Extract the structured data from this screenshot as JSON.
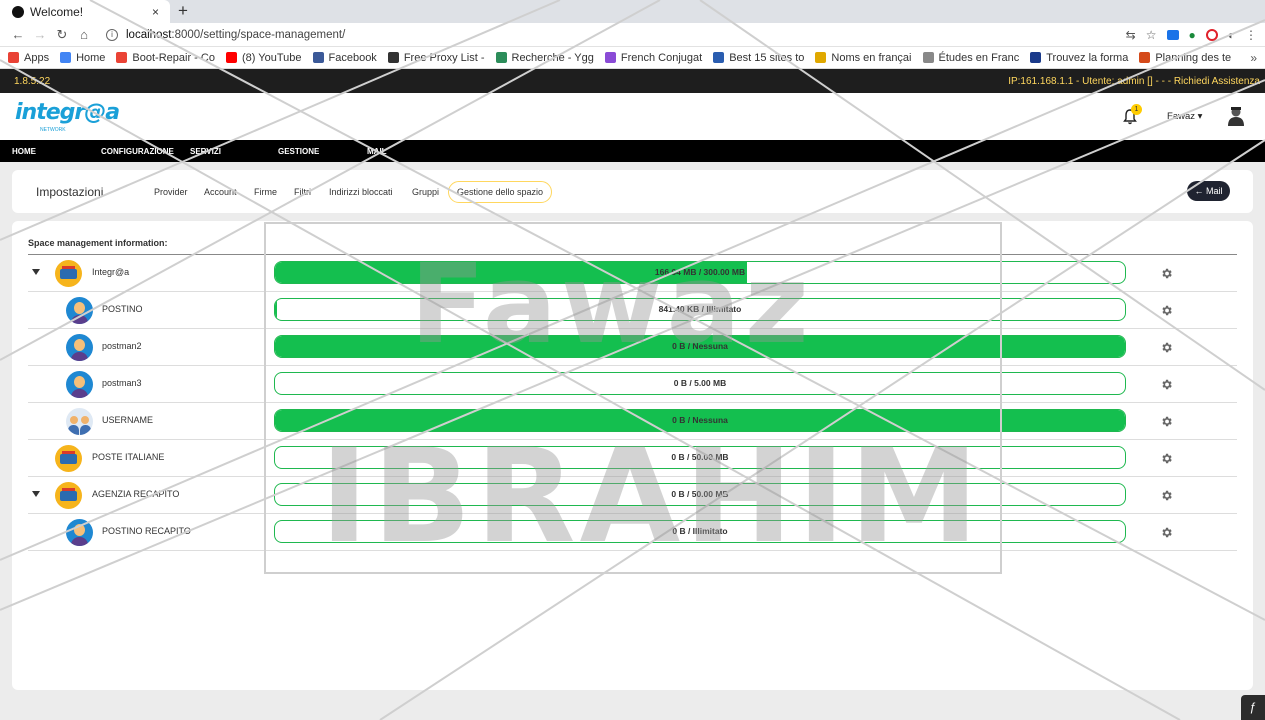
{
  "browser": {
    "tab_title": "Welcome!",
    "tab_close": "×",
    "new_tab": "+",
    "url_host": "localhost",
    "url_path": ":8000/setting/space-management/",
    "bookmarks": [
      {
        "label": "Apps",
        "color": "#e94235"
      },
      {
        "label": "Home",
        "color": "#4285f4"
      },
      {
        "label": "Boot-Repair - Co",
        "color": "#ea4335"
      },
      {
        "label": "(8) YouTube",
        "color": "#ff0000"
      },
      {
        "label": "Facebook",
        "color": "#3b5998"
      },
      {
        "label": "Free Proxy List -",
        "color": "#333333"
      },
      {
        "label": "Recherche - Ygg",
        "color": "#2c8d5a"
      },
      {
        "label": "French Conjugat",
        "color": "#8a4bd6"
      },
      {
        "label": "Best 15 sites to",
        "color": "#2a5db0"
      },
      {
        "label": "Noms en françai",
        "color": "#e0a800"
      },
      {
        "label": "Études en Franc",
        "color": "#888888"
      },
      {
        "label": "Trouvez la forma",
        "color": "#1a3a8a"
      },
      {
        "label": "Planning des te",
        "color": "#d44a1a"
      }
    ],
    "bookmarks_more": "»"
  },
  "statusbar": {
    "version": "1.8.5.22",
    "info": "IP:161.168.1.1 - Utente: admin [] - - - Richiedi Assistenza"
  },
  "header": {
    "logo_text": "integr@a",
    "logo_sub": "NETWORK",
    "notif_count": "1",
    "username": "Fawaz"
  },
  "mainnav": [
    "HOME",
    "CONFIGURAZIONE",
    "SERVIZI",
    "GESTIONE",
    "MAIL"
  ],
  "subnav": {
    "heading": "Impostazioni",
    "links": [
      "Provider",
      "Account",
      "Firme",
      "Filtri",
      "Indirizzi bloccati",
      "Gruppi",
      "Gestione dello spazio"
    ],
    "active_index": 6,
    "mail_button": "Mail"
  },
  "panel": {
    "title": "Space management information:",
    "rows": [
      {
        "label": "Integr@a",
        "icon": "org-icon",
        "level": 0,
        "expanded": true,
        "usage": "166.64 MB / 300.00 MB",
        "fill": 0.555
      },
      {
        "label": "POSTINO",
        "icon": "person-icon",
        "level": 1,
        "expanded": false,
        "usage": "841.40 KB / Illimitato",
        "fill": 0.002
      },
      {
        "label": "postman2",
        "icon": "person-icon",
        "level": 1,
        "expanded": false,
        "usage": "0 B / Nessuna",
        "fill": 1
      },
      {
        "label": "postman3",
        "icon": "person-icon",
        "level": 1,
        "expanded": false,
        "usage": "0 B / 5.00 MB",
        "fill": 0
      },
      {
        "label": "USERNAME",
        "icon": "group-icon",
        "level": 1,
        "expanded": false,
        "usage": "0 B / Nessuna",
        "fill": 1
      },
      {
        "label": "POSTE ITALIANE",
        "icon": "org-icon",
        "level": 0,
        "expanded": false,
        "usage": "0 B / 50.00 MB",
        "fill": 0
      },
      {
        "label": "AGENZIA RECAPITO",
        "icon": "org-icon",
        "level": 0,
        "expanded": true,
        "usage": "0 B / 50.00 MB",
        "fill": 0
      },
      {
        "label": "POSTINO RECAPITO",
        "icon": "person-icon",
        "level": 1,
        "expanded": false,
        "usage": "0 B / Illimitato",
        "fill": 0
      }
    ]
  },
  "watermark": {
    "line1": "Fawaz",
    "line2": "IBRAHIM"
  }
}
